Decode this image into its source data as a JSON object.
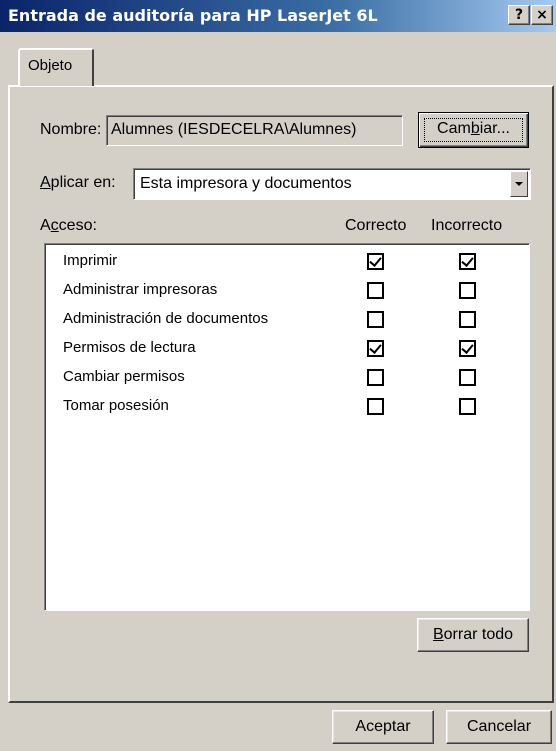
{
  "window": {
    "title": "Entrada de auditoría para HP LaserJet 6L",
    "help_label": "?",
    "close_label": "×"
  },
  "tabs": [
    {
      "label": "Objeto",
      "selected": true
    }
  ],
  "name": {
    "label": "Nombre:",
    "value": "Alumnes (IESDECELRA\\Alumnes)",
    "change_button": "Cambiar..."
  },
  "apply": {
    "label": "Aplicar en:",
    "selected": "Esta impresora y documentos"
  },
  "access": {
    "label": "Acceso:",
    "col_success": "Correcto",
    "col_failure": "Incorrecto",
    "rows": [
      {
        "label": "Imprimir",
        "success": true,
        "failure": true
      },
      {
        "label": "Administrar impresoras",
        "success": false,
        "failure": false
      },
      {
        "label": "Administración de documentos",
        "success": false,
        "failure": false
      },
      {
        "label": "Permisos de lectura",
        "success": true,
        "failure": true
      },
      {
        "label": "Cambiar permisos",
        "success": false,
        "failure": false
      },
      {
        "label": "Tomar posesión",
        "success": false,
        "failure": false
      }
    ],
    "clear_button": "Borrar todo"
  },
  "footer": {
    "ok_button": "Aceptar",
    "cancel_button": "Cancelar"
  }
}
